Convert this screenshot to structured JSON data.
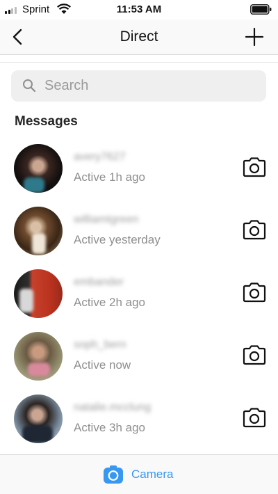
{
  "status_bar": {
    "carrier": "Sprint",
    "time": "11:53 AM",
    "signal_icon": "signal-bars-icon",
    "wifi_icon": "wifi-icon",
    "battery_icon": "battery-icon"
  },
  "nav": {
    "title": "Direct",
    "back_icon": "chevron-left-icon",
    "add_icon": "plus-icon"
  },
  "search": {
    "placeholder": "Search",
    "value": "",
    "icon": "search-icon"
  },
  "messages": {
    "heading": "Messages",
    "items": [
      {
        "username": "avery7627",
        "status": "Active 1h ago"
      },
      {
        "username": "williamtgreen",
        "status": "Active yesterday"
      },
      {
        "username": "embander",
        "status": "Active 2h ago"
      },
      {
        "username": "soph_bern",
        "status": "Active now"
      },
      {
        "username": "natalie.mcclung",
        "status": "Active 3h ago"
      }
    ]
  },
  "bottom_bar": {
    "camera_label": "Camera",
    "camera_icon": "camera-icon"
  },
  "colors": {
    "accent": "#3897f0",
    "secondary_text": "#8e8e8e",
    "search_bg": "#efefef",
    "nav_bg": "#f9f9f9"
  }
}
